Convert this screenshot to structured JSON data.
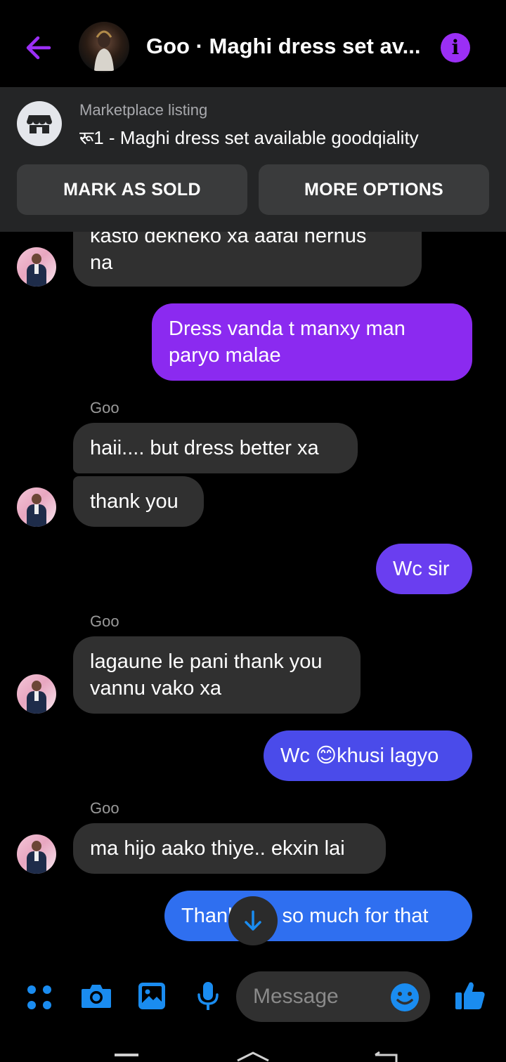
{
  "header": {
    "title": "Goo · Maghi dress set av...",
    "info_label": "i"
  },
  "listing": {
    "label": "Marketplace listing",
    "title": "रू1 - Maghi dress set available goodqiality",
    "mark_sold_label": "MARK AS SOLD",
    "more_options_label": "MORE OPTIONS"
  },
  "messages": [
    {
      "direction": "in",
      "lines": [
        "kasto dekheko xa aafai hernus",
        "na"
      ]
    },
    {
      "direction": "out",
      "lines": [
        "Dress vanda t manxy man",
        "paryo malae"
      ]
    },
    {
      "direction": "in",
      "sender": "Goo",
      "lines": [
        "haii.... but dress better xa"
      ]
    },
    {
      "direction": "in",
      "lines": [
        "thank you"
      ]
    },
    {
      "direction": "out",
      "lines": [
        "Wc sir"
      ]
    },
    {
      "direction": "in",
      "sender": "Goo",
      "lines": [
        "lagaune le pani thank you",
        "vannu vako xa"
      ]
    },
    {
      "direction": "out",
      "lines": [
        "Wc 😊khusi lagyo"
      ]
    },
    {
      "direction": "in",
      "sender": "Goo",
      "lines": [
        "ma hijo aako thiye.. ekxin lai"
      ]
    },
    {
      "direction": "out",
      "lines": [
        "Thank you so much for that"
      ]
    }
  ],
  "composer": {
    "placeholder": "Message"
  },
  "colors": {
    "accent": "#9b2ff5",
    "icon_blue": "#1a8cf0",
    "bubble_in": "#303030",
    "banner_bg": "#242526",
    "button_bg": "#3a3b3c"
  },
  "icons": [
    "back-arrow-icon",
    "info-icon",
    "store-icon",
    "apps-icon",
    "camera-icon",
    "gallery-icon",
    "microphone-icon",
    "emoji-icon",
    "thumbs-up-icon",
    "arrow-down-icon"
  ]
}
